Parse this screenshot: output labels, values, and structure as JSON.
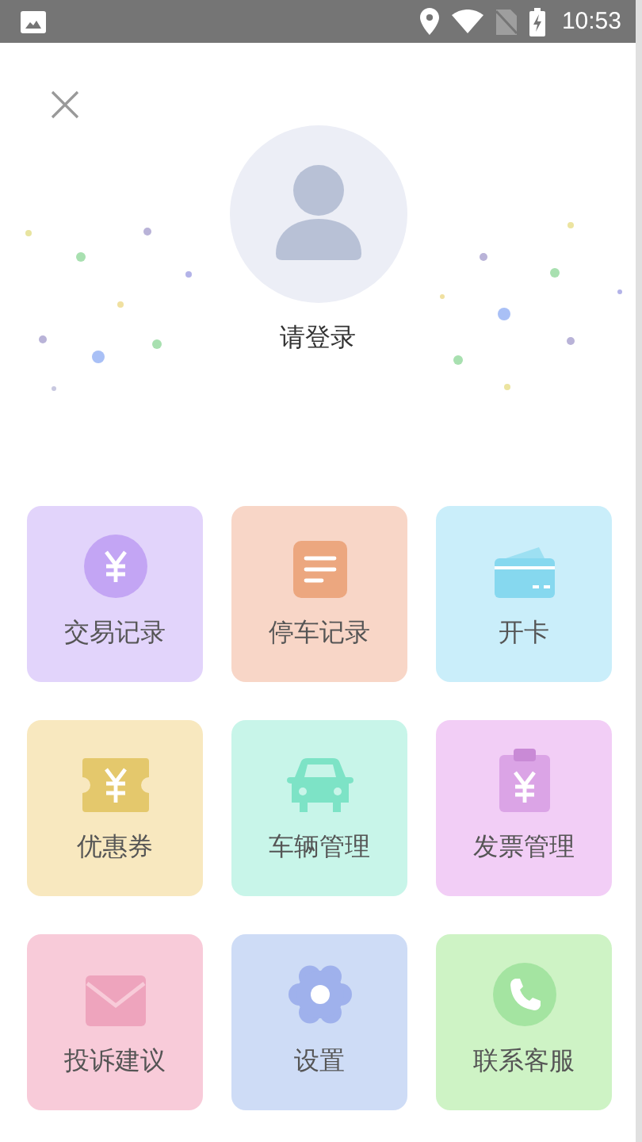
{
  "status_bar": {
    "time": "10:53"
  },
  "profile": {
    "login_prompt": "请登录"
  },
  "menu": [
    {
      "label": "交易记录",
      "kind": "yen-coin",
      "color": "#e2d4fb"
    },
    {
      "label": "停车记录",
      "kind": "document",
      "color": "#f8d6c7"
    },
    {
      "label": "开卡",
      "kind": "card",
      "color": "#caeefa"
    },
    {
      "label": "优惠券",
      "kind": "ticket",
      "color": "#f8e8bf"
    },
    {
      "label": "车辆管理",
      "kind": "car",
      "color": "#c8f5e9"
    },
    {
      "label": "发票管理",
      "kind": "clipboard",
      "color": "#f2cef6"
    },
    {
      "label": "投诉建议",
      "kind": "envelope",
      "color": "#f8cbd9"
    },
    {
      "label": "设置",
      "kind": "gear",
      "color": "#cedcf6"
    },
    {
      "label": "联系客服",
      "kind": "phone",
      "color": "#cef3c5"
    }
  ]
}
